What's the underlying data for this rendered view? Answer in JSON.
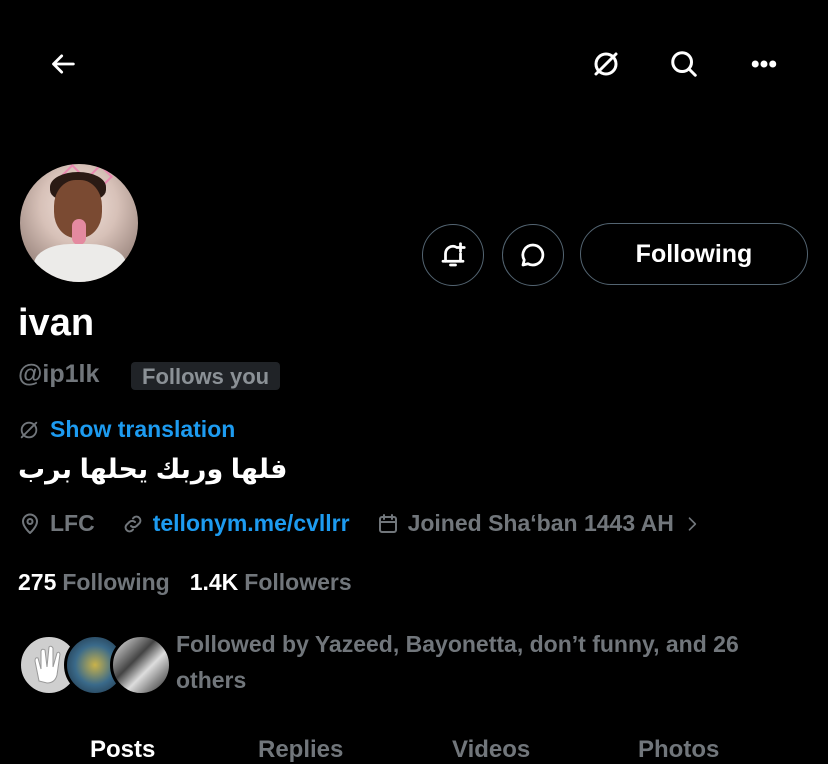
{
  "header": {
    "back_icon": "arrow-left-icon",
    "translate_icon": "translate-slash-icon",
    "search_icon": "search-icon",
    "more_icon": "more-horizontal-icon"
  },
  "profile": {
    "name": "ivan",
    "handle": "@ip1lk",
    "follows_you": "Follows you",
    "show_translation": "Show translation",
    "bio": "فلها وربك يحلها برب",
    "location": "LFC",
    "website": "tellonym.me/cvllrr",
    "joined": "Joined Sha‘ban 1443 AH"
  },
  "actions": {
    "notify_icon": "bell-plus-icon",
    "message_icon": "message-bubble-icon",
    "following_label": "Following"
  },
  "stats": {
    "following_count": "275",
    "following_label": "Following",
    "followers_count": "1.4K",
    "followers_label": "Followers"
  },
  "followed_by": {
    "text": "Followed by Yazeed, Bayonetta, don’t funny, and 26 others"
  },
  "tabs": [
    {
      "label": "Posts"
    },
    {
      "label": "Replies"
    },
    {
      "label": "Videos"
    },
    {
      "label": "Photos"
    }
  ],
  "colors": {
    "accent": "#1d9bf0",
    "muted": "#71767b",
    "border": "#536471"
  }
}
